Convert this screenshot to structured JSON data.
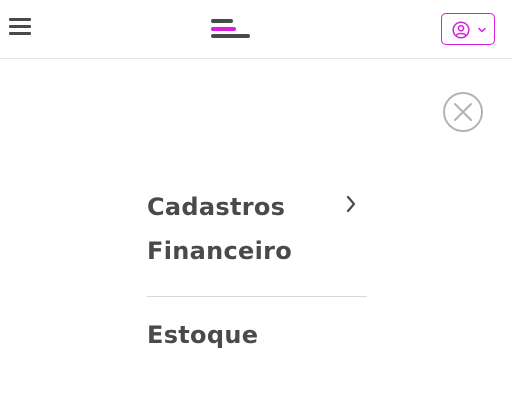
{
  "header": {
    "menu_icon": "hamburger-menu-icon",
    "logo_icon": "brand-bars-logo",
    "user_icon": "user-circle-icon",
    "dropdown_icon": "chevron-down-icon",
    "colors": {
      "accent": "#d91de0",
      "logo_dark": "#4a4a4a",
      "text": "#4a4a4a",
      "divider": "#d9d9d9"
    }
  },
  "close_icon": "close-circle-icon",
  "menu": {
    "items": [
      {
        "label": "Cadastros",
        "has_submenu": true,
        "arrow_icon": "chevron-right-icon"
      },
      {
        "label": "Financeiro",
        "has_submenu": false
      },
      {
        "label": "Estoque",
        "has_submenu": false
      }
    ]
  }
}
